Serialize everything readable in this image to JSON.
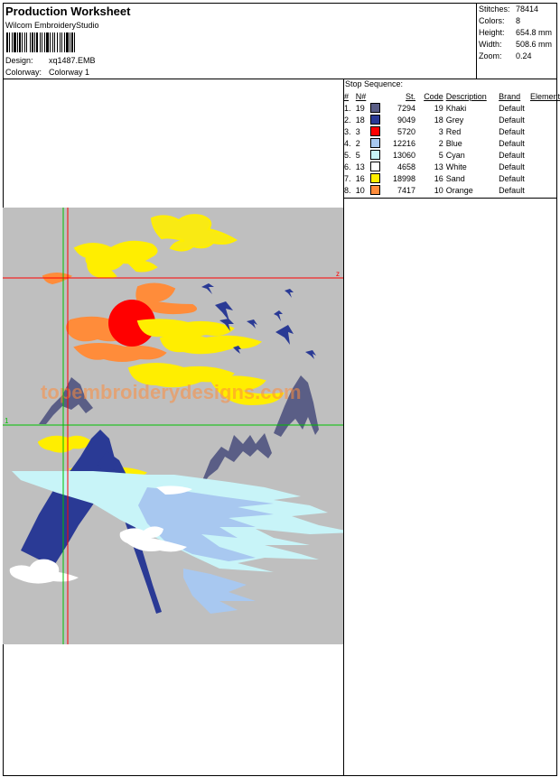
{
  "header": {
    "title": "Production Worksheet",
    "software": "Wilcom EmbroideryStudio",
    "design_label": "Design:",
    "design_value": "xq1487.EMB",
    "colorway_label": "Colorway:",
    "colorway_value": "Colorway 1"
  },
  "stats": [
    {
      "label": "Stitches:",
      "value": "78414"
    },
    {
      "label": "Colors:",
      "value": "8"
    },
    {
      "label": "Height:",
      "value": "654.8 mm"
    },
    {
      "label": "Width:",
      "value": "508.6 mm"
    },
    {
      "label": "Zoom:",
      "value": "0.24"
    }
  ],
  "stop_sequence": {
    "title": "Stop Sequence:",
    "headers": [
      "#",
      "N#",
      "St.",
      "Code",
      "Description",
      "Brand",
      "Element"
    ],
    "rows": [
      {
        "seq": "1.",
        "n": "19",
        "color": "#5a5e86",
        "st": "7294",
        "code": "19",
        "desc": "Khaki",
        "brand": "Default",
        "element": ""
      },
      {
        "seq": "2.",
        "n": "18",
        "color": "#2a3a95",
        "st": "9049",
        "code": "18",
        "desc": "Grey",
        "brand": "Default",
        "element": ""
      },
      {
        "seq": "3.",
        "n": "3",
        "color": "#ff0000",
        "st": "5720",
        "code": "3",
        "desc": "Red",
        "brand": "Default",
        "element": ""
      },
      {
        "seq": "4.",
        "n": "2",
        "color": "#a8c8f0",
        "st": "12216",
        "code": "2",
        "desc": "Blue",
        "brand": "Default",
        "element": ""
      },
      {
        "seq": "5.",
        "n": "5",
        "color": "#c8f4f8",
        "st": "13060",
        "code": "5",
        "desc": "Cyan",
        "brand": "Default",
        "element": ""
      },
      {
        "seq": "6.",
        "n": "13",
        "color": "#ffffff",
        "st": "4658",
        "code": "13",
        "desc": "White",
        "brand": "Default",
        "element": ""
      },
      {
        "seq": "7.",
        "n": "16",
        "color": "#ffee00",
        "st": "18998",
        "code": "16",
        "desc": "Sand",
        "brand": "Default",
        "element": ""
      },
      {
        "seq": "8.",
        "n": "10",
        "color": "#ff8c3a",
        "st": "7417",
        "code": "10",
        "desc": "Orange",
        "brand": "Default",
        "element": ""
      }
    ]
  },
  "preview": {
    "background": "#bfbfbf",
    "watermark": "topembroiderydesigns.com",
    "axis_label_x": "z",
    "axis_label_y": "1"
  }
}
